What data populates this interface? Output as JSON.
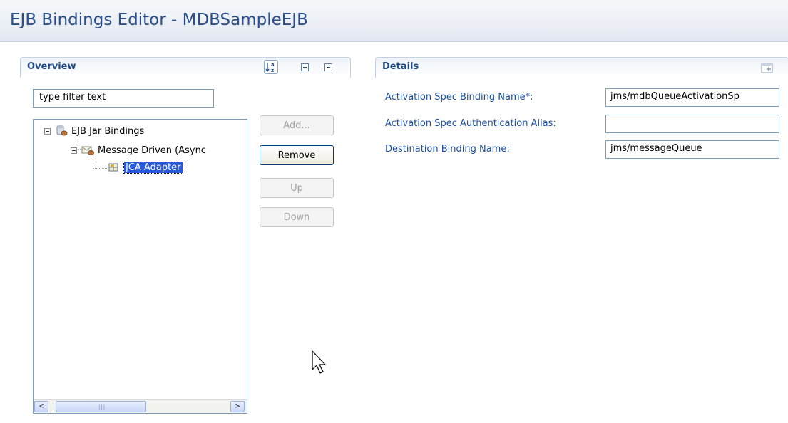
{
  "editor": {
    "title": "EJB Bindings Editor - MDBSampleEJB"
  },
  "overview": {
    "header": "Overview",
    "toolbar": [
      {
        "name": "sort-alphabetical-icon",
        "tooltip": ""
      },
      {
        "name": "expand-all-icon",
        "tooltip": ""
      },
      {
        "name": "collapse-all-icon",
        "tooltip": ""
      }
    ],
    "filter_value": "type filter text",
    "tree": [
      {
        "label": "EJB Jar Bindings",
        "icon": "jar-bindings-icon",
        "level": 0,
        "expanded": true
      },
      {
        "label": "Message Driven (Async",
        "icon": "message-driven-icon",
        "level": 1,
        "expanded": true
      },
      {
        "label": "JCA Adapter",
        "icon": "jca-adapter-icon",
        "level": 2,
        "selected": true
      }
    ],
    "buttons": {
      "add": "Add...",
      "remove": "Remove",
      "up": "Up",
      "down": "Down"
    },
    "scrollbar": {
      "left_arrow": "<",
      "right_arrow": ">"
    }
  },
  "details": {
    "header": "Details",
    "fields": [
      {
        "label": "Activation Spec Binding Name*:",
        "value": "jms/mdbQueueActivationSp"
      },
      {
        "label": "Activation Spec Authentication Alias:",
        "value": ""
      },
      {
        "label": "Destination Binding Name:",
        "value": "jms/messageQueue"
      }
    ]
  },
  "colors": {
    "title": "#2a4f8a",
    "section_header": "#1f4a8a",
    "field_label": "#1a4fa3",
    "selection": "#2a5bd7"
  }
}
